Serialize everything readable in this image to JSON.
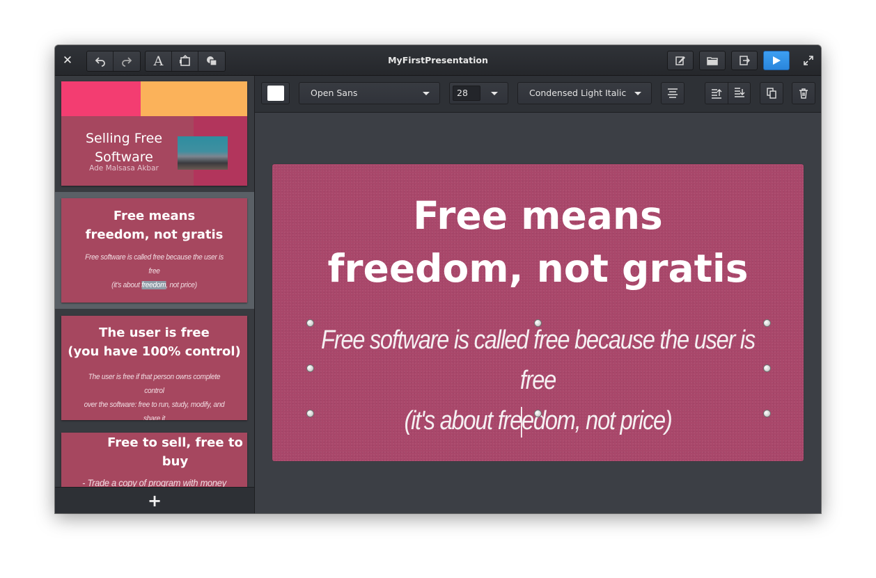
{
  "window": {
    "title": "MyFirstPresentation"
  },
  "titlebar": {
    "close_icon": "close-icon",
    "left_groups": [
      [
        "undo-icon",
        "redo-icon"
      ],
      [
        "text-icon",
        "image-icon",
        "shape-icon"
      ]
    ],
    "right_buttons": [
      "edit-notes-icon",
      "open-folder-icon",
      "export-icon",
      "play-icon"
    ],
    "maximize_icon": "maximize-icon",
    "present_color": "#3597ee"
  },
  "toolbar": {
    "text_color": "#ffffff",
    "font_family": "Open Sans",
    "font_size": "28",
    "font_style": "Condensed Light Italic",
    "icons": [
      "align-center-icon",
      "bring-forward-icon",
      "send-backward-icon",
      "duplicate-icon",
      "delete-icon"
    ]
  },
  "slides": [
    {
      "title": "Selling Free Software",
      "title_lines": [
        "Selling Free",
        "Software"
      ],
      "subtitle": "Ade Malsasa Akbar"
    },
    {
      "title_lines": [
        "Free means",
        "freedom, not gratis"
      ],
      "body_lines": [
        "Free software is called free because the user is free",
        "(it's about ",
        "freedom",
        ", not price)"
      ],
      "selected": true
    },
    {
      "title_lines": [
        "The user is free",
        "(you have 100% control)"
      ],
      "body_lines": [
        "The user is free if that person owns complete control",
        "over the software: free to run, study, modify, and",
        "share it"
      ]
    },
    {
      "title_lines": [
        "Free to sell, free to",
        "buy"
      ],
      "body_lines": [
        "- Trade a copy of program with money"
      ]
    }
  ],
  "sidebar_footer": {
    "add_label": "+"
  },
  "editor": {
    "title_lines": [
      "Free means",
      "freedom, not gratis"
    ],
    "body_line1": "Free software is called free because the user is free",
    "body_line2_before": "(it's about fre",
    "body_line2_after": "edom, not price)",
    "slide_color": "#a9476a"
  }
}
